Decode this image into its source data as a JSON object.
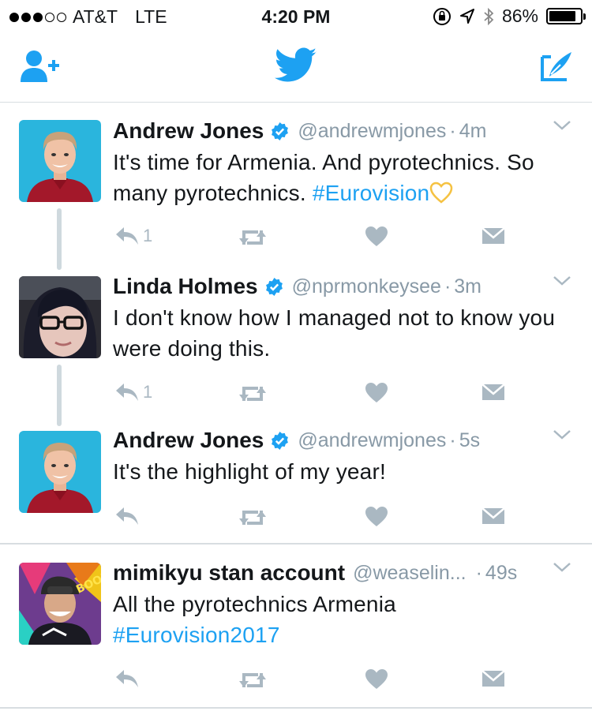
{
  "status_bar": {
    "carrier": "AT&T",
    "network": "LTE",
    "time": "4:20 PM",
    "battery_percent": "86%",
    "battery_level": 0.86,
    "signal_bars_filled": 3,
    "signal_bars_total": 5
  },
  "nav": {
    "left_icon": "add-user-icon",
    "center_icon": "twitter-bird-icon",
    "right_icon": "compose-icon",
    "accent": "#1da1f2"
  },
  "tweets": [
    {
      "name": "Andrew Jones",
      "verified": true,
      "handle": "@andrewmjones",
      "separator": "·",
      "time": "4m",
      "text_plain": "It's time for Armenia. And pyrotechnics. So many pyrotechnics.",
      "hashtag": "#Eurovision",
      "emoji": "yellow-heart-icon",
      "reply_count": "1"
    },
    {
      "name": "Linda Holmes",
      "verified": true,
      "handle": "@nprmonkeysee",
      "separator": "·",
      "time": "3m",
      "text_plain": "I don't know how I managed not to know you were doing this.",
      "reply_count": "1"
    },
    {
      "name": "Andrew Jones",
      "verified": true,
      "handle": "@andrewmjones",
      "separator": "·",
      "time": "5s",
      "text_plain": "It's the highlight of my year!",
      "reply_count": ""
    },
    {
      "name": "mimikyu stan account",
      "verified": false,
      "handle": "@weaselin...",
      "separator": "·",
      "time": "49s",
      "text_plain": "All the pyrotechnics Armenia",
      "hashtag": "#Eurovision2017",
      "reply_count": ""
    }
  ]
}
